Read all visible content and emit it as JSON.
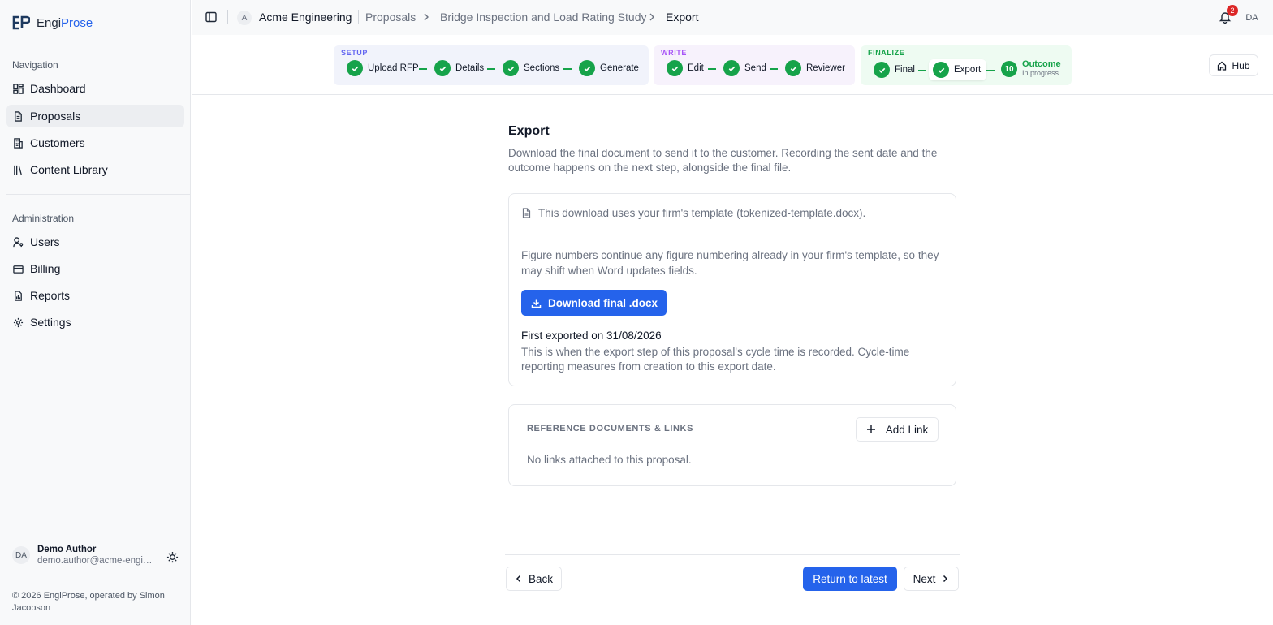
{
  "brand": {
    "prefix": "Engi",
    "accent": "Prose"
  },
  "sidebar": {
    "nav_label": "Navigation",
    "nav_items": [
      {
        "label": "Dashboard",
        "icon": "dashboard-icon"
      },
      {
        "label": "Proposals",
        "icon": "document-icon",
        "active": true
      },
      {
        "label": "Customers",
        "icon": "building-icon"
      },
      {
        "label": "Content Library",
        "icon": "library-icon"
      }
    ],
    "admin_label": "Administration",
    "admin_items": [
      {
        "label": "Users",
        "icon": "user-key-icon"
      },
      {
        "label": "Billing",
        "icon": "credit-card-icon"
      },
      {
        "label": "Reports",
        "icon": "report-icon"
      },
      {
        "label": "Settings",
        "icon": "gear-icon"
      }
    ],
    "user": {
      "initials": "DA",
      "name": "Demo Author",
      "email": "demo.author@acme-engineering.com"
    },
    "copyright": "© 2026 EngiProse, operated by Simon Jacobson"
  },
  "topbar": {
    "org_initial": "A",
    "org_name": "Acme Engineering",
    "breadcrumb": [
      "Proposals",
      "Bridge Inspection and Load Rating Study",
      "Export"
    ],
    "notification_count": "2",
    "user_initials": "DA"
  },
  "stepper": {
    "setup": {
      "label": "SETUP",
      "steps": [
        "Upload RFP",
        "Details",
        "Sections",
        "Generate"
      ]
    },
    "write": {
      "label": "WRITE",
      "steps": [
        "Edit",
        "Send",
        "Reviewer"
      ]
    },
    "finalize": {
      "label": "FINALIZE",
      "steps": [
        "Final",
        "Export"
      ],
      "outcome": {
        "number": "10",
        "label": "Outcome",
        "status": "In progress"
      }
    },
    "hub_label": "Hub"
  },
  "main": {
    "title": "Export",
    "description": "Download the final document to send it to the customer. Recording the sent date and the outcome happens on the next step, alongside the final file.",
    "template_note": "This download uses your firm's template (tokenized-template.docx).",
    "figure_note": "Figure numbers continue any figure numbering already in your firm's template, so they may shift when Word updates fields.",
    "download_label": "Download final .docx",
    "exported_title": "First exported on 31/08/2026",
    "exported_note": "This is when the export step of this proposal's cycle time is recorded. Cycle-time reporting measures from creation to this export date.",
    "references": {
      "title": "REFERENCE DOCUMENTS & LINKS",
      "add_label": "Add Link",
      "empty": "No links attached to this proposal."
    }
  },
  "footer": {
    "back": "Back",
    "latest": "Return to latest",
    "next": "Next"
  },
  "colors": {
    "primary": "#2563eb",
    "success": "#16a34a",
    "badge": "#dc2626"
  }
}
